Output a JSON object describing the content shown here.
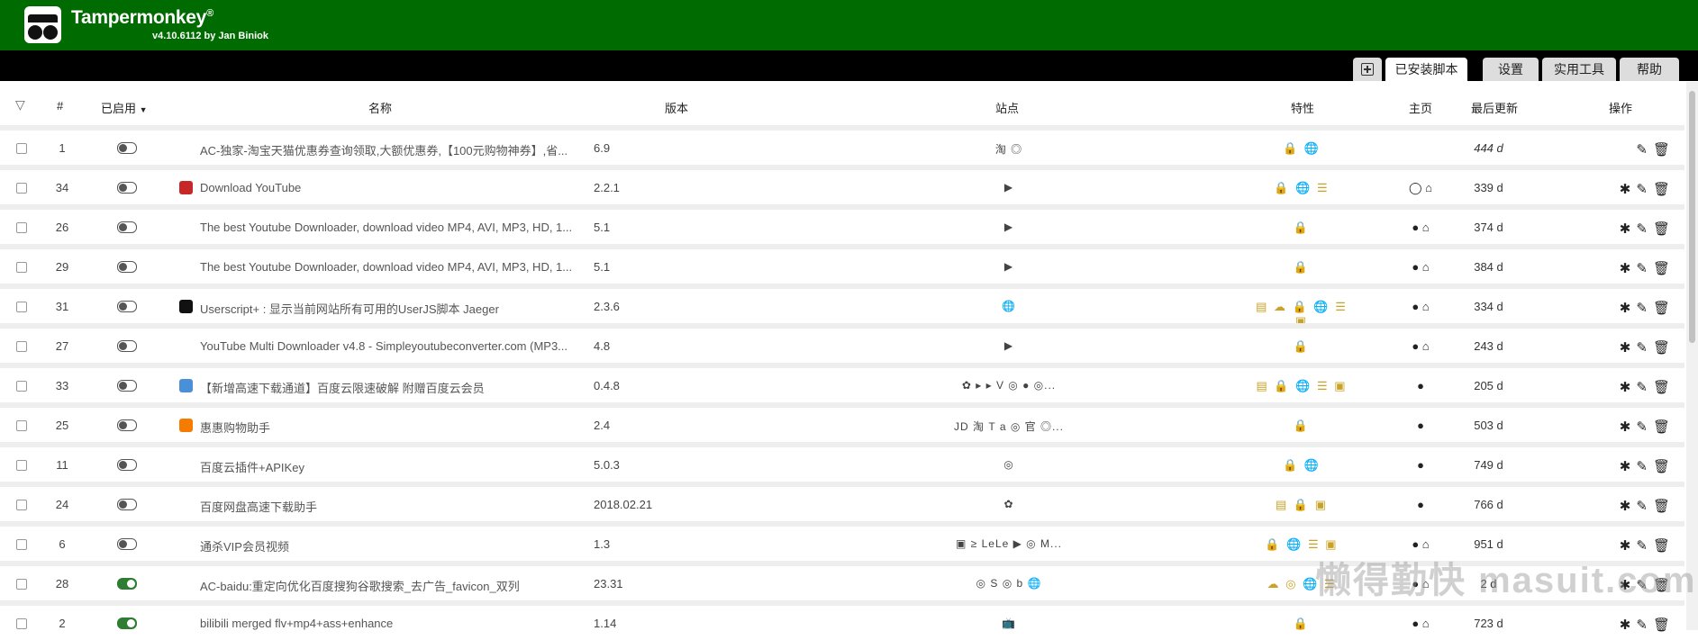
{
  "app": {
    "title": "Tampermonkey",
    "reg": "®",
    "subtitle": "v4.10.6112 by Jan Biniok"
  },
  "tabs": [
    {
      "label": "已安装脚本"
    },
    {
      "label": "设置"
    },
    {
      "label": "实用工具"
    },
    {
      "label": "帮助"
    }
  ],
  "table": {
    "columns": {
      "num": "#",
      "enabled": "已启用",
      "name": "名称",
      "version": "版本",
      "sites": "站点",
      "features": "特性",
      "homepage": "主页",
      "updated": "最后更新",
      "actions": "操作"
    },
    "rows": [
      {
        "num": "1",
        "enabled": false,
        "name": "AC-独家-淘宝天猫优惠券查询领取,大额优惠券,【100元购物神券】,省...",
        "version": "6.9",
        "sites": "淘 ◎",
        "features": "🔒 🌐",
        "home": "",
        "updated": "444 d"
      },
      {
        "num": "34",
        "enabled": false,
        "name": "Download YouTube",
        "version": "2.2.1",
        "sites": "▶",
        "features": "🔒 🌐 ☰",
        "home": "◯ ⌂",
        "updated": "339 d"
      },
      {
        "num": "26",
        "enabled": false,
        "name": "The best Youtube Downloader, download video MP4, AVI, MP3, HD, 1...",
        "version": "5.1",
        "sites": "▶",
        "features": "🔒",
        "home": "● ⌂",
        "updated": "374 d"
      },
      {
        "num": "29",
        "enabled": false,
        "name": "The best Youtube Downloader, download video MP4, AVI, MP3, HD, 1...",
        "version": "5.1",
        "sites": "▶",
        "features": "🔒",
        "home": "● ⌂",
        "updated": "384 d"
      },
      {
        "num": "31",
        "enabled": false,
        "name": "Userscript+ : 显示当前网站所有可用的UserJS脚本 Jaeger",
        "version": "2.3.6",
        "sites": "🌐",
        "features": "▤ ☁ 🔒 🌐 ☰ ▣",
        "home": "● ⌂",
        "updated": "334 d"
      },
      {
        "num": "27",
        "enabled": false,
        "name": "YouTube Multi Downloader v4.8 - Simpleyoutubeconverter.com (MP3...",
        "version": "4.8",
        "sites": "▶",
        "features": "🔒",
        "home": "● ⌂",
        "updated": "243 d"
      },
      {
        "num": "33",
        "enabled": false,
        "name": "【新增高速下载通道】百度云限速破解 附赠百度云会员",
        "version": "0.4.8",
        "sites": "✿ ▸ ▸ V ◎ ● ◎...",
        "features": "▤ 🔒 🌐 ☰ ▣",
        "home": "●",
        "updated": "205 d"
      },
      {
        "num": "25",
        "enabled": false,
        "name": "惠惠购物助手",
        "version": "2.4",
        "sites": "JD 淘 T a ◎ 官 ◎...",
        "features": "🔒",
        "home": "●",
        "updated": "503 d"
      },
      {
        "num": "11",
        "enabled": false,
        "name": "百度云插件+APIKey",
        "version": "5.0.3",
        "sites": "◎",
        "features": "🔒 🌐",
        "home": "●",
        "updated": "749 d"
      },
      {
        "num": "24",
        "enabled": false,
        "name": "百度网盘高速下载助手",
        "version": "2018.02.21",
        "sites": "✿",
        "features": "▤ 🔒 ▣",
        "home": "●",
        "updated": "766 d"
      },
      {
        "num": "6",
        "enabled": false,
        "name": "通杀VIP会员视频",
        "version": "1.3",
        "sites": "▣ ≥ LeLe ▶ ◎ M...",
        "features": "🔒 🌐 ☰ ▣",
        "home": "● ⌂",
        "updated": "951 d"
      },
      {
        "num": "28",
        "enabled": true,
        "name": "AC-baidu:重定向优化百度搜狗谷歌搜索_去广告_favicon_双列",
        "version": "23.31",
        "sites": "◎ S ◎ b 🌐",
        "features": "☁ ◎ 🌐 ☰",
        "home": "● ⌂",
        "updated": "2 d"
      },
      {
        "num": "2",
        "enabled": true,
        "name": "bilibili merged flv+mp4+ass+enhance",
        "version": "1.14",
        "sites": "📺",
        "features": "🔒",
        "home": "● ⌂",
        "updated": "723 d"
      }
    ]
  },
  "watermark": "懒得勤快 masuit.com",
  "colors": {
    "brand": "#006b00",
    "tabbar": "#000000",
    "toggle_on": "#2e7d32",
    "lock": "#c9a227"
  }
}
